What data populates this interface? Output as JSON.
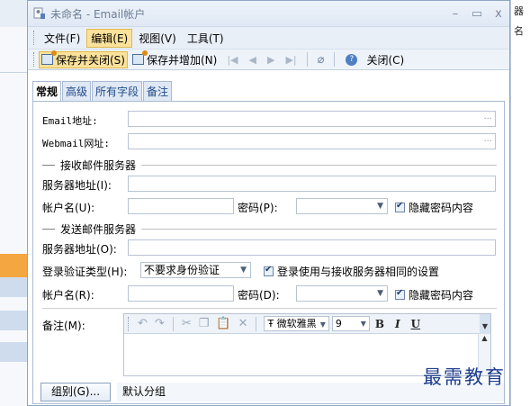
{
  "window": {
    "title": "未命名 - Email帐户",
    "minimize": "–",
    "maximize": "▭",
    "close": "x"
  },
  "background": {
    "right_texts": [
      "器",
      "名"
    ]
  },
  "menus": [
    {
      "label": "文件(F)"
    },
    {
      "label": "编辑(E)"
    },
    {
      "label": "视图(V)"
    },
    {
      "label": "工具(T)"
    }
  ],
  "toolbar": {
    "save_close": "保存并关闭(S)",
    "save_add": "保存并增加(N)",
    "close": "关闭(C)"
  },
  "tabs": [
    {
      "label": "常规"
    },
    {
      "label": "高级"
    },
    {
      "label": "所有字段"
    },
    {
      "label": "备注"
    }
  ],
  "form": {
    "email_label": "Email地址:",
    "webmail_label": "Webmail网址:",
    "incoming_section": "接收邮件服务器",
    "incoming_server_label": "服务器地址(I):",
    "incoming_account_label": "帐户名(U):",
    "incoming_password_label": "密码(P):",
    "incoming_hide_password": "隐藏密码内容",
    "outgoing_section": "发送邮件服务器",
    "outgoing_server_label": "服务器地址(O):",
    "auth_type_label": "登录验证类型(H):",
    "auth_type_value": "不要求身份验证",
    "same_settings_label": "登录使用与接收服务器相同的设置",
    "outgoing_account_label": "帐户名(R):",
    "outgoing_password_label": "密码(D):",
    "outgoing_hide_password": "隐藏密码内容",
    "notes_label": "备注(M):",
    "group_button": "组别(G)...",
    "group_value": "默认分组"
  },
  "editor": {
    "font_name": "微软雅黑",
    "font_size": "9",
    "bold": "B",
    "italic": "I",
    "underline": "U"
  },
  "watermark": "最需教育"
}
